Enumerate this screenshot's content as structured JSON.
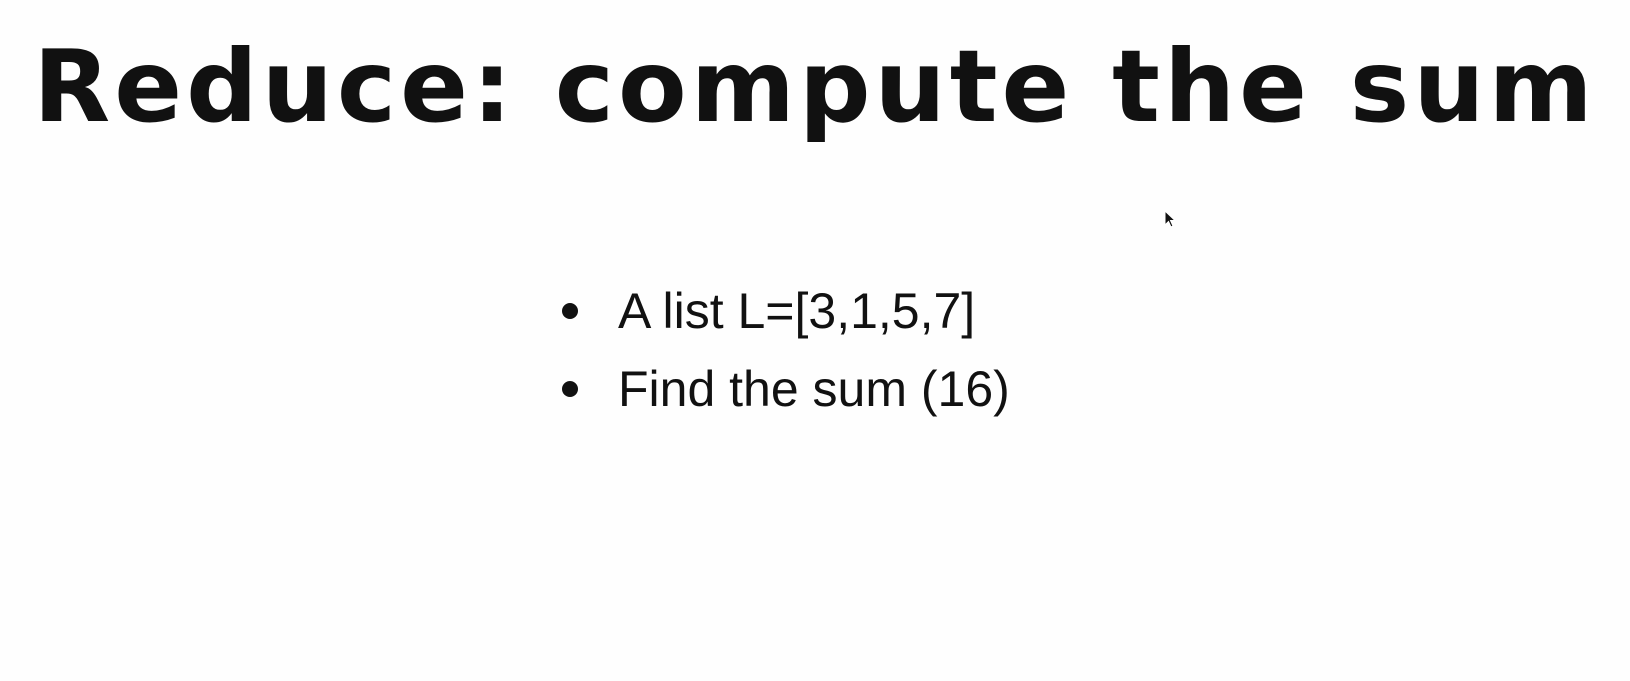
{
  "slide": {
    "title": "Reduce: compute the sum",
    "bullets": [
      {
        "text": "A list L=[3,1,5,7]"
      },
      {
        "text": "Find the sum (16)"
      }
    ]
  }
}
